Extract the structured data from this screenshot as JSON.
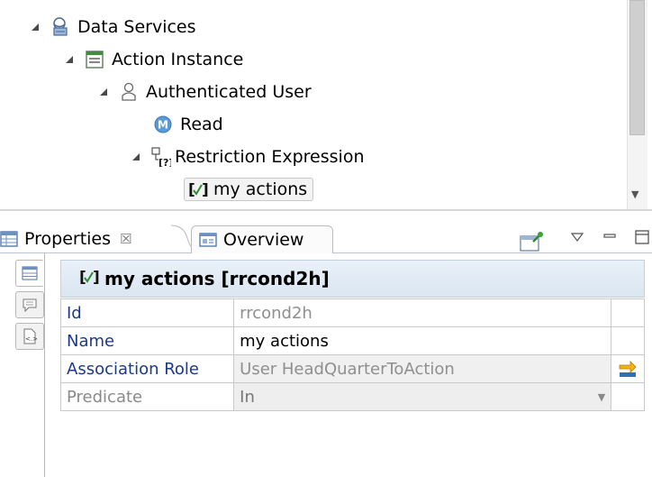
{
  "tree": {
    "nodes": [
      {
        "label": "Data Services",
        "icon": "data-services-icon"
      },
      {
        "label": "Action Instance",
        "icon": "entity-icon"
      },
      {
        "label": "Authenticated User",
        "icon": "user-role-icon"
      },
      {
        "label": "Read",
        "icon": "method-m-icon"
      },
      {
        "label": "Restriction Expression",
        "icon": "restriction-icon"
      },
      {
        "label": "my actions",
        "icon": "condition-icon",
        "selected": true
      }
    ]
  },
  "view": {
    "tabs": [
      {
        "label": "Properties",
        "icon": "properties-icon"
      },
      {
        "label": "Overview",
        "icon": "overview-icon"
      }
    ],
    "header_title": "my actions [rrcond2h]",
    "rows": [
      {
        "key": "Id",
        "value": "rrcond2h"
      },
      {
        "key": "Name",
        "value": "my actions"
      },
      {
        "key": "Association Role",
        "value": "User HeadQuarterToAction"
      },
      {
        "key": "Predicate",
        "value": "In"
      }
    ]
  },
  "colors": {
    "accent_blue": "#1b3a8c",
    "header_bg": "#e4ecf6",
    "icon_green": "#2e8b2e"
  }
}
